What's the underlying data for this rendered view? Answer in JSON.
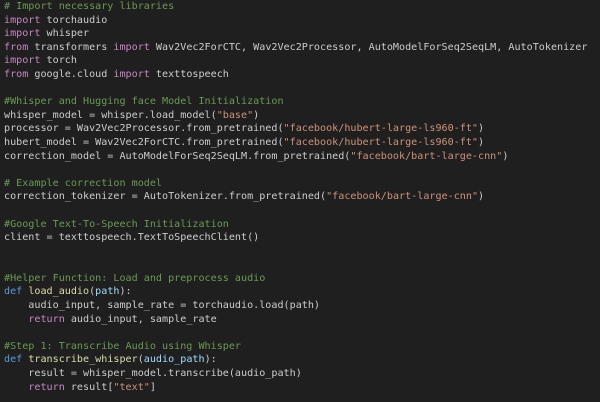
{
  "theme": {
    "background": "#1f1f1f",
    "colors": {
      "comment": "#6a9955",
      "keyword": "#c586c0",
      "def": "#569cd6",
      "func": "#dcdcaa",
      "string": "#ce9178",
      "param": "#9cdcfe",
      "plain": "#cccccc"
    }
  },
  "code": {
    "lines": [
      [
        {
          "t": "comment",
          "v": "# Import necessary libraries"
        }
      ],
      [
        {
          "t": "keyword",
          "v": "import"
        },
        {
          "t": "plain",
          "v": " torchaudio"
        }
      ],
      [
        {
          "t": "keyword",
          "v": "import"
        },
        {
          "t": "plain",
          "v": " whisper"
        }
      ],
      [
        {
          "t": "keyword",
          "v": "from"
        },
        {
          "t": "plain",
          "v": " transformers "
        },
        {
          "t": "keyword",
          "v": "import"
        },
        {
          "t": "plain",
          "v": " Wav2Vec2ForCTC, Wav2Vec2Processor, AutoModelForSeq2SeqLM, AutoTokenizer"
        }
      ],
      [
        {
          "t": "keyword",
          "v": "import"
        },
        {
          "t": "plain",
          "v": " torch"
        }
      ],
      [
        {
          "t": "keyword",
          "v": "from"
        },
        {
          "t": "plain",
          "v": " google.cloud "
        },
        {
          "t": "keyword",
          "v": "import"
        },
        {
          "t": "plain",
          "v": " texttospeech"
        }
      ],
      [],
      [
        {
          "t": "comment",
          "v": "#Whisper and Hugging face Model Initialization"
        }
      ],
      [
        {
          "t": "plain",
          "v": "whisper_model = whisper.load_model("
        },
        {
          "t": "string",
          "v": "\"base\""
        },
        {
          "t": "plain",
          "v": ")"
        }
      ],
      [
        {
          "t": "plain",
          "v": "processor = Wav2Vec2Processor.from_pretrained("
        },
        {
          "t": "string",
          "v": "\"facebook/hubert-large-ls960-ft\""
        },
        {
          "t": "plain",
          "v": ")"
        }
      ],
      [
        {
          "t": "plain",
          "v": "hubert_model = Wav2Vec2ForCTC.from_pretrained("
        },
        {
          "t": "string",
          "v": "\"facebook/hubert-large-ls960-ft\""
        },
        {
          "t": "plain",
          "v": ")"
        }
      ],
      [
        {
          "t": "plain",
          "v": "correction_model = AutoModelForSeq2SeqLM.from_pretrained("
        },
        {
          "t": "string",
          "v": "\"facebook/bart-large-cnn\""
        },
        {
          "t": "plain",
          "v": ")"
        }
      ],
      [],
      [
        {
          "t": "comment",
          "v": "# Example correction model"
        }
      ],
      [
        {
          "t": "plain",
          "v": "correction_tokenizer = AutoTokenizer.from_pretrained("
        },
        {
          "t": "string",
          "v": "\"facebook/bart-large-cnn\""
        },
        {
          "t": "plain",
          "v": ")"
        }
      ],
      [],
      [
        {
          "t": "comment",
          "v": "#Google Text-To-Speech Initialization"
        }
      ],
      [
        {
          "t": "plain",
          "v": "client = texttospeech.TextToSpeechClient()"
        }
      ],
      [],
      [],
      [
        {
          "t": "comment",
          "v": "#Helper Function: Load and preprocess audio"
        }
      ],
      [
        {
          "t": "def",
          "v": "def"
        },
        {
          "t": "plain",
          "v": " "
        },
        {
          "t": "func",
          "v": "load_audio"
        },
        {
          "t": "plain",
          "v": "("
        },
        {
          "t": "param",
          "v": "path"
        },
        {
          "t": "plain",
          "v": "):"
        }
      ],
      [
        {
          "t": "plain",
          "v": "    audio_input, sample_rate = torchaudio.load(path)"
        }
      ],
      [
        {
          "t": "plain",
          "v": "    "
        },
        {
          "t": "keyword",
          "v": "return"
        },
        {
          "t": "plain",
          "v": " audio_input, sample_rate"
        }
      ],
      [],
      [
        {
          "t": "comment",
          "v": "#Step 1: Transcribe Audio using Whisper"
        }
      ],
      [
        {
          "t": "def",
          "v": "def"
        },
        {
          "t": "plain",
          "v": " "
        },
        {
          "t": "func",
          "v": "transcribe_whisper"
        },
        {
          "t": "plain",
          "v": "("
        },
        {
          "t": "param",
          "v": "audio_path"
        },
        {
          "t": "plain",
          "v": "):"
        }
      ],
      [
        {
          "t": "plain",
          "v": "    result = whisper_model.transcribe(audio_path)"
        }
      ],
      [
        {
          "t": "plain",
          "v": "    "
        },
        {
          "t": "keyword",
          "v": "return"
        },
        {
          "t": "plain",
          "v": " result["
        },
        {
          "t": "string",
          "v": "\"text\""
        },
        {
          "t": "plain",
          "v": "]"
        }
      ]
    ]
  }
}
